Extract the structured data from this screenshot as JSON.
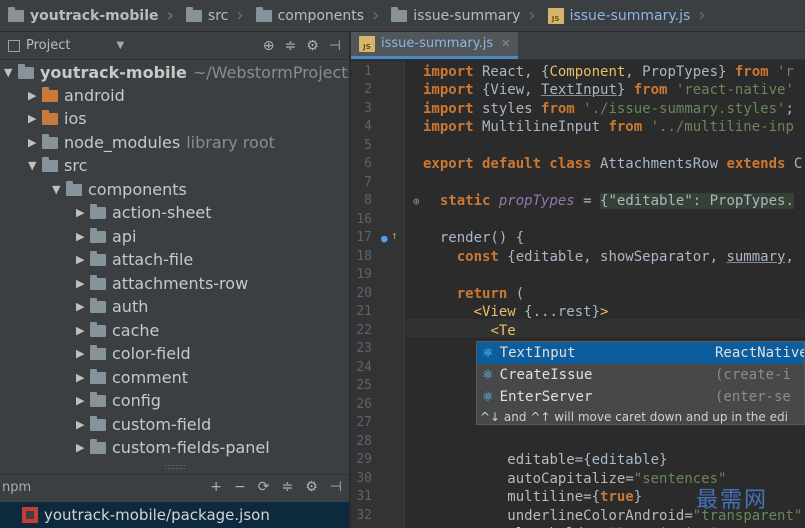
{
  "breadcrumb": {
    "items": [
      "youtrack-mobile",
      "src",
      "components",
      "issue-summary",
      "issue-summary.js"
    ]
  },
  "project_panel": {
    "title": "Project",
    "tree": [
      {
        "label": "youtrack-mobile",
        "hint": "~/WebstormProjects/"
      },
      {
        "label": "android",
        "hint": ""
      },
      {
        "label": "ios",
        "hint": ""
      },
      {
        "label": "node_modules",
        "hint": "library root"
      },
      {
        "label": "src",
        "hint": ""
      },
      {
        "label": "components",
        "hint": ""
      },
      {
        "label": "action-sheet",
        "hint": ""
      },
      {
        "label": "api",
        "hint": ""
      },
      {
        "label": "attach-file",
        "hint": ""
      },
      {
        "label": "attachments-row",
        "hint": ""
      },
      {
        "label": "auth",
        "hint": ""
      },
      {
        "label": "cache",
        "hint": ""
      },
      {
        "label": "color-field",
        "hint": ""
      },
      {
        "label": "comment",
        "hint": ""
      },
      {
        "label": "config",
        "hint": ""
      },
      {
        "label": "custom-field",
        "hint": ""
      },
      {
        "label": "custom-fields-panel",
        "hint": ""
      }
    ],
    "npm_label": "npm",
    "package_item": "youtrack-mobile/package.json"
  },
  "editor": {
    "tab_label": "issue-summary.js",
    "line_numbers": [
      "1",
      "2",
      "3",
      "4",
      "5",
      "6",
      "7",
      "8",
      "16",
      "17",
      "18",
      "19",
      "20",
      "21",
      "22",
      "23",
      "24",
      "25",
      "26",
      "27",
      "28",
      "29",
      "30",
      "31",
      "32"
    ]
  },
  "completion": {
    "items": [
      {
        "name": "TextInput",
        "source": "ReactNative"
      },
      {
        "name": "CreateIssue",
        "source": "(create-i"
      },
      {
        "name": "EnterServer",
        "source": "(enter-se"
      }
    ],
    "hint": "^↓ and ^↑ will move caret down and up in the edi"
  },
  "watermark": "最需网"
}
